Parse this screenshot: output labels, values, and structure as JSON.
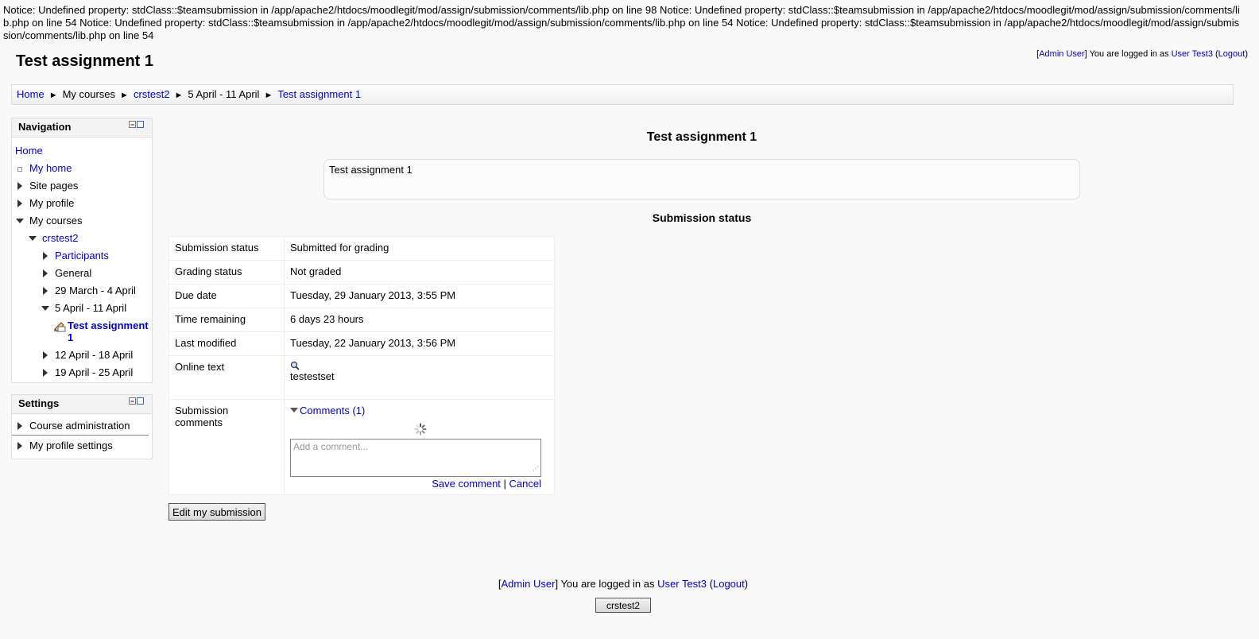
{
  "notice": "Notice: Undefined property: stdClass::$teamsubmission in /app/apache2/htdocs/moodlegit/mod/assign/submission/comments/lib.php on line 98 Notice: Undefined property: stdClass::$teamsubmission in /app/apache2/htdocs/moodlegit/mod/assign/submission/comments/lib.php on line 54 Notice: Undefined property: stdClass::$teamsubmission in /app/apache2/htdocs/moodlegit/mod/assign/submission/comments/lib.php on line 54 Notice: Undefined property: stdClass::$teamsubmission in /app/apache2/htdocs/moodlegit/mod/assign/submission/comments/lib.php on line 54",
  "header": {
    "title": "Test assignment 1",
    "login": {
      "admin_user": "Admin User",
      "logged_in_text": "You are logged in as",
      "user": "User Test3",
      "logout": "Logout"
    }
  },
  "breadcrumb": [
    "Home",
    "My courses",
    "crstest2",
    "5 April - 11 April",
    "Test assignment 1"
  ],
  "navigation": {
    "title": "Navigation",
    "home": "Home",
    "my_home": "My home",
    "site_pages": "Site pages",
    "my_profile": "My profile",
    "my_courses": "My courses",
    "course": "crstest2",
    "participants": "Participants",
    "general": "General",
    "week1": "29 March - 4 April",
    "week2": "5 April - 11 April",
    "assignment": "Test assignment 1",
    "week3": "12 April - 18 April",
    "week4": "19 April - 25 April"
  },
  "settings": {
    "title": "Settings",
    "course_admin": "Course administration",
    "profile_settings": "My profile settings"
  },
  "main": {
    "title": "Test assignment 1",
    "intro": "Test assignment 1",
    "section_title": "Submission status",
    "rows": [
      {
        "label": "Submission status",
        "value": "Submitted for grading"
      },
      {
        "label": "Grading status",
        "value": "Not graded"
      },
      {
        "label": "Due date",
        "value": "Tuesday, 29 January 2013, 3:55 PM"
      },
      {
        "label": "Time remaining",
        "value": "6 days 23 hours"
      },
      {
        "label": "Last modified",
        "value": "Tuesday, 22 January 2013, 3:56 PM"
      },
      {
        "label": "Online text",
        "value": "testestset"
      },
      {
        "label": "Submission comments",
        "value": ""
      }
    ],
    "comments_link": "Comments (1)",
    "comment_placeholder": "Add a comment...",
    "save_comment": "Save comment",
    "cancel": "Cancel",
    "edit_button": "Edit my submission"
  },
  "footer": {
    "admin_user": "Admin User",
    "logged_in_text": "You are logged in as",
    "user": "User Test3",
    "logout": "Logout",
    "course_button": "crstest2"
  }
}
